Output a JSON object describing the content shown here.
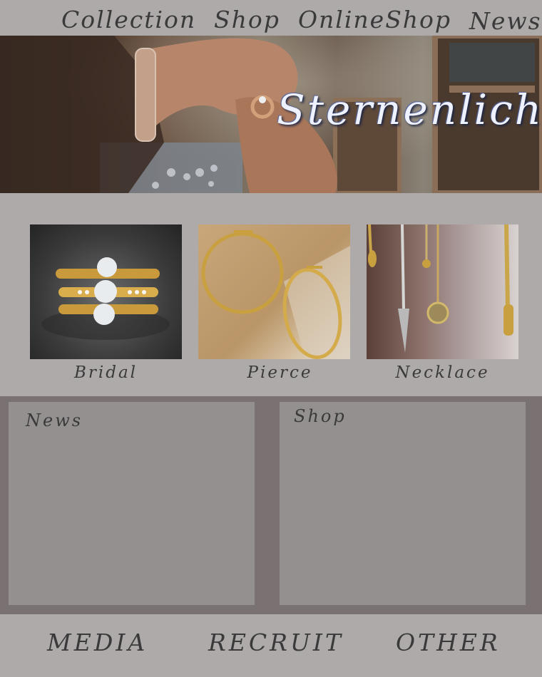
{
  "nav": {
    "items": [
      "Collection",
      "Shop",
      "OnlineShop",
      "News"
    ]
  },
  "hero": {
    "brand": "Sternenlicht"
  },
  "products": [
    {
      "label": "Bridal"
    },
    {
      "label": "Pierce"
    },
    {
      "label": "Necklace"
    }
  ],
  "panels": {
    "news_title": "News",
    "shop_title": "Shop"
  },
  "footer": {
    "items": [
      "MEDIA",
      "RECRUIT",
      "OTHER"
    ]
  },
  "colors": {
    "background": "#aeaaaa",
    "band": "#7a7272",
    "panel": "#949090",
    "text": "#3a3a3a",
    "brand_text": "#eef1ff"
  }
}
